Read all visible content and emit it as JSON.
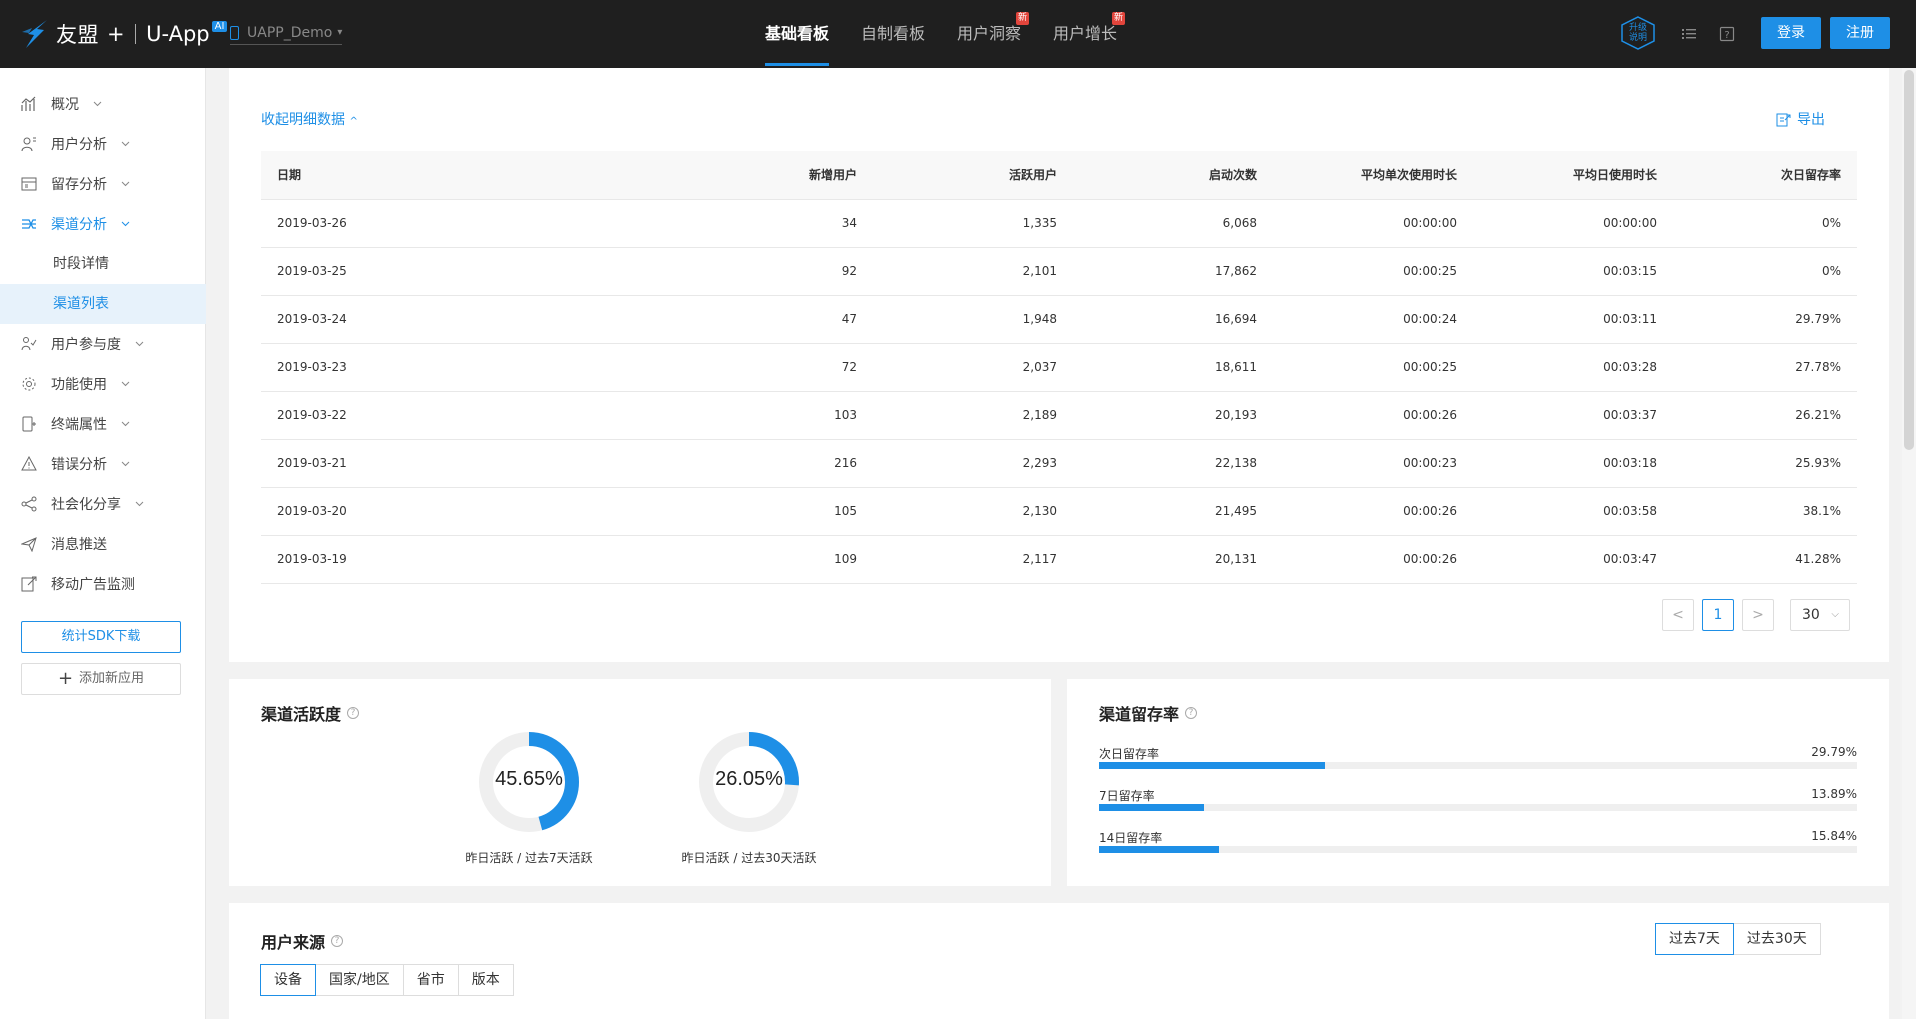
{
  "header": {
    "brand": "友盟",
    "brand_plus": "+",
    "product": "U-App",
    "ai_badge": "AI",
    "app_name": "UAPP_Demo",
    "nav": [
      {
        "label": "基础看板",
        "active": true,
        "badge": ""
      },
      {
        "label": "自制看板",
        "active": false,
        "badge": ""
      },
      {
        "label": "用户洞察",
        "active": false,
        "badge": "新"
      },
      {
        "label": "用户增长",
        "active": false,
        "badge": "新"
      }
    ],
    "upgrade_line1": "升级",
    "upgrade_line2": "说明",
    "login_label": "登录",
    "register_label": "注册"
  },
  "sidebar": {
    "items": [
      {
        "label": "概况",
        "icon": "chart-icon"
      },
      {
        "label": "用户分析",
        "icon": "user-analysis-icon"
      },
      {
        "label": "留存分析",
        "icon": "retention-icon"
      },
      {
        "label": "渠道分析",
        "icon": "channel-icon"
      },
      {
        "label": "用户参与度",
        "icon": "engagement-icon"
      },
      {
        "label": "功能使用",
        "icon": "gear-icon"
      },
      {
        "label": "终端属性",
        "icon": "device-icon"
      },
      {
        "label": "错误分析",
        "icon": "warning-icon"
      },
      {
        "label": "社会化分享",
        "icon": "share-icon"
      },
      {
        "label": "消息推送",
        "icon": "send-icon"
      },
      {
        "label": "移动广告监测",
        "icon": "ad-monitor-icon"
      }
    ],
    "sub_items": [
      {
        "label": "时段详情"
      },
      {
        "label": "渠道列表"
      }
    ],
    "sdk_button": "统计SDK下载",
    "add_app_button": "添加新应用"
  },
  "detail": {
    "collapse_label": "收起明细数据",
    "export_label": "导出",
    "columns": [
      "日期",
      "新增用户",
      "活跃用户",
      "启动次数",
      "平均单次使用时长",
      "平均日使用时长",
      "次日留存率"
    ],
    "rows": [
      [
        "2019-03-26",
        "34",
        "1,335",
        "6,068",
        "00:00:00",
        "00:00:00",
        "0%"
      ],
      [
        "2019-03-25",
        "92",
        "2,101",
        "17,862",
        "00:00:25",
        "00:03:15",
        "0%"
      ],
      [
        "2019-03-24",
        "47",
        "1,948",
        "16,694",
        "00:00:24",
        "00:03:11",
        "29.79%"
      ],
      [
        "2019-03-23",
        "72",
        "2,037",
        "18,611",
        "00:00:25",
        "00:03:28",
        "27.78%"
      ],
      [
        "2019-03-22",
        "103",
        "2,189",
        "20,193",
        "00:00:26",
        "00:03:37",
        "26.21%"
      ],
      [
        "2019-03-21",
        "216",
        "2,293",
        "22,138",
        "00:00:23",
        "00:03:18",
        "25.93%"
      ],
      [
        "2019-03-20",
        "105",
        "2,130",
        "21,495",
        "00:00:26",
        "00:03:58",
        "38.1%"
      ],
      [
        "2019-03-19",
        "109",
        "2,117",
        "20,131",
        "00:00:26",
        "00:03:47",
        "41.28%"
      ]
    ],
    "pagination": {
      "prev": "<",
      "current_page": "1",
      "next": ">",
      "page_size": "30"
    }
  },
  "activity": {
    "title": "渠道活跃度",
    "rings": [
      {
        "value_text": "45.65%",
        "value": 45.65,
        "caption": "昨日活跃 / 过去7天活跃"
      },
      {
        "value_text": "26.05%",
        "value": 26.05,
        "caption": "昨日活跃 / 过去30天活跃"
      }
    ]
  },
  "retention": {
    "title": "渠道留存率",
    "rows": [
      {
        "label": "次日留存率",
        "value_text": "29.79%",
        "value": 29.79
      },
      {
        "label": "7日留存率",
        "value_text": "13.89%",
        "value": 13.89
      },
      {
        "label": "14日留存率",
        "value_text": "15.84%",
        "value": 15.84
      }
    ]
  },
  "source": {
    "title": "用户来源",
    "range_tabs": [
      {
        "label": "过去7天",
        "active": true
      },
      {
        "label": "过去30天",
        "active": false
      }
    ],
    "dimension_tabs": [
      {
        "label": "设备",
        "active": true
      },
      {
        "label": "国家/地区",
        "active": false
      },
      {
        "label": "省市",
        "active": false
      },
      {
        "label": "版本",
        "active": false
      }
    ]
  },
  "colors": {
    "accent": "#1e8fe6",
    "topbar": "#1f1f1f",
    "badge": "#e2453c"
  }
}
